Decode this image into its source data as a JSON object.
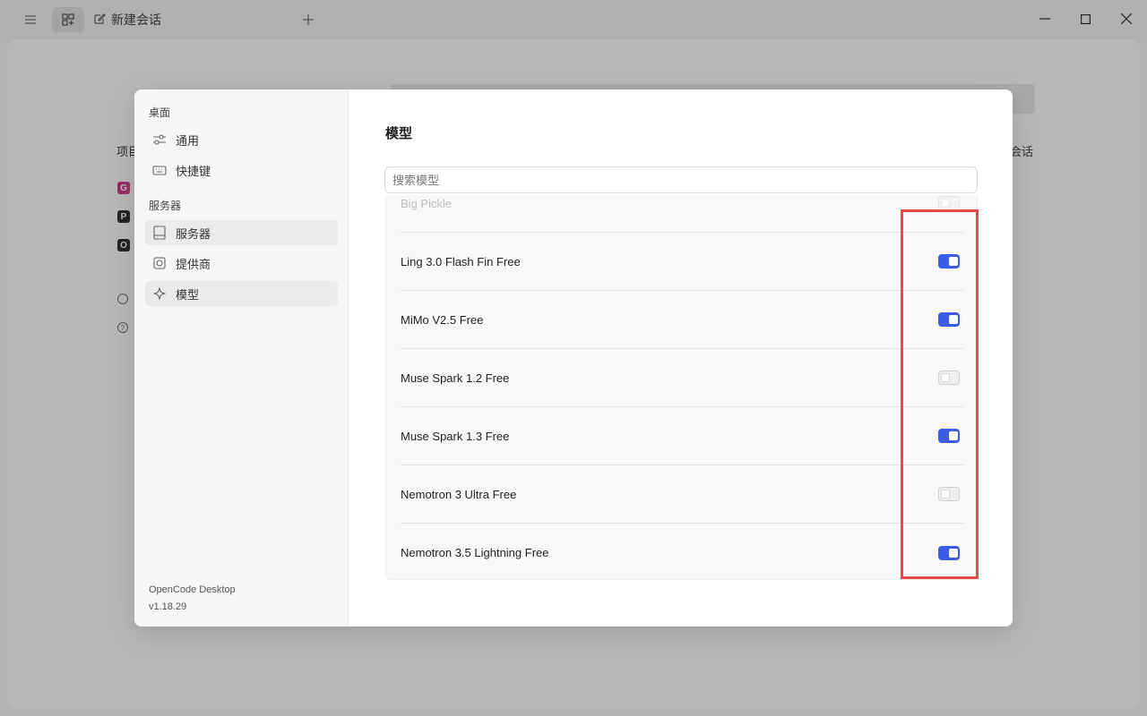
{
  "titlebar": {
    "tab_label": "新建会话"
  },
  "background": {
    "projects_label": "项目",
    "right_label": "会话",
    "badges": [
      "G",
      "P",
      "O"
    ],
    "badge_colors": [
      "#d53f8c",
      "#333333",
      "#333333"
    ]
  },
  "sidebar": {
    "group_desktop": "桌面",
    "items_desktop": [
      {
        "label": "通用",
        "icon": "sliders-icon"
      },
      {
        "label": "快捷键",
        "icon": "keyboard-icon"
      }
    ],
    "group_server": "服务器",
    "items_server": [
      {
        "label": "服务器",
        "icon": "server-icon"
      },
      {
        "label": "提供商",
        "icon": "provider-icon"
      },
      {
        "label": "模型",
        "icon": "sparkle-icon"
      }
    ],
    "app_name": "OpenCode Desktop",
    "version": "v1.18.29"
  },
  "content": {
    "title": "模型",
    "search_placeholder": "搜索模型",
    "models": [
      {
        "name": "Big Pickle",
        "enabled": false,
        "partially_hidden": true
      },
      {
        "name": "Ling 3.0 Flash Fin Free",
        "enabled": true
      },
      {
        "name": "MiMo V2.5 Free",
        "enabled": true
      },
      {
        "name": "Muse Spark 1.2 Free",
        "enabled": false
      },
      {
        "name": "Muse Spark 1.3 Free",
        "enabled": true
      },
      {
        "name": "Nemotron 3 Ultra Free",
        "enabled": false
      },
      {
        "name": "Nemotron 3.5 Lightning Free",
        "enabled": true
      }
    ]
  },
  "colors": {
    "accent": "#3c5ce6",
    "highlight": "#e5484d"
  }
}
